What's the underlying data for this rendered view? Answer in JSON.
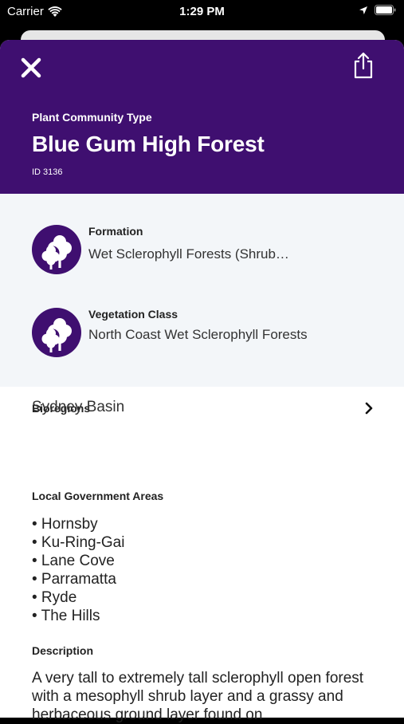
{
  "status_bar": {
    "carrier": "Carrier",
    "time": "1:29 PM"
  },
  "header": {
    "subtitle": "Plant Community Type",
    "title": "Blue Gum High Forest",
    "id_text": "ID 3136",
    "background_color": "#3f0f70"
  },
  "classification": [
    {
      "label": "Formation",
      "value": "Wet Sclerophyll Forests (Shrub…",
      "icon": "trees-icon"
    },
    {
      "label": "Vegetation Class",
      "value": "North Coast Wet Sclerophyll Forests",
      "icon": "trees-icon"
    }
  ],
  "bioregions": {
    "label": "Bioregions",
    "items": [
      "Sydney Basin"
    ]
  },
  "lga": {
    "label": "Local Government Areas",
    "items": [
      "• Hornsby",
      "• Ku-Ring-Gai",
      "• Lane Cove",
      "• Parramatta",
      "• Ryde",
      "• The Hills"
    ]
  },
  "description": {
    "label": "Description",
    "text": "A very tall to extremely tall sclerophyll open forest with a mesophyll shrub layer and a grassy and herbaceous ground layer found on"
  }
}
